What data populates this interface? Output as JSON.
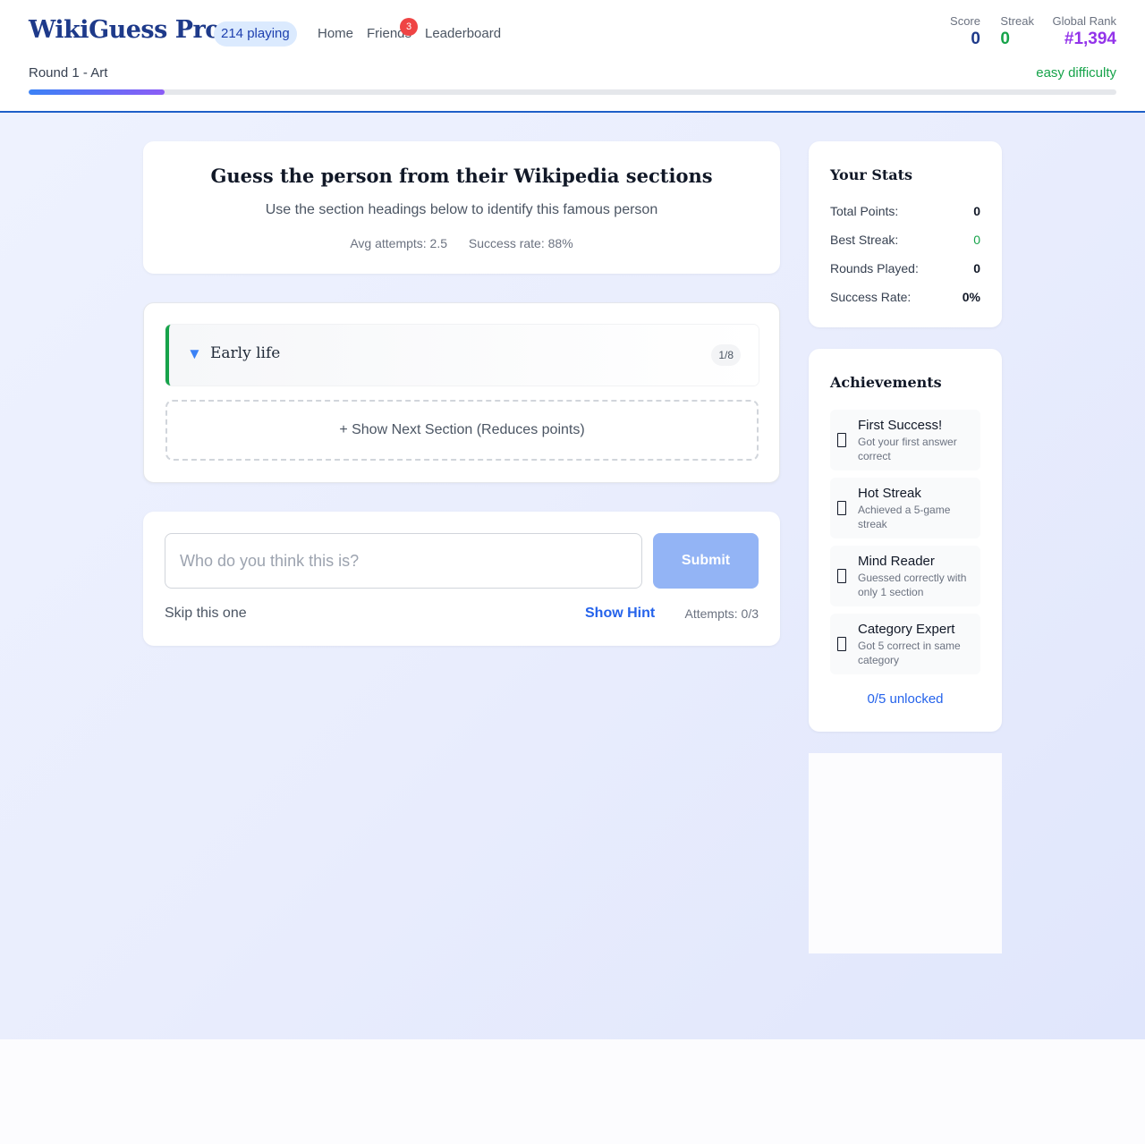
{
  "header": {
    "logo": "WikiGuess Pro",
    "playing_badge": "214 playing",
    "nav": [
      {
        "label": "Home"
      },
      {
        "label": "Friends",
        "notification_count": "3"
      },
      {
        "label": "Leaderboard"
      }
    ],
    "stats": [
      {
        "label": "Score",
        "value": "0",
        "color": "#1e3a8a"
      },
      {
        "label": "Streak",
        "value": "0",
        "color": "#16a34a"
      },
      {
        "label": "Global Rank",
        "value": "#1,394",
        "color": "#9333ea"
      }
    ],
    "round_label": "Round 1 - Art",
    "difficulty": "easy difficulty",
    "progress_fraction": 0.125
  },
  "intro": {
    "title": "Guess the person from their Wikipedia sections",
    "subtitle": "Use the section headings below to identify this famous person",
    "avg_attempts": "Avg attempts: 2.5",
    "success_rate": "Success rate: 88%"
  },
  "sections": {
    "items": [
      {
        "arrow": "▼",
        "title": "Early life",
        "count": "1/8"
      }
    ],
    "show_next_label": "+ Show Next Section (Reduces points)"
  },
  "guess": {
    "placeholder": "Who do you think this is?",
    "submit_label": "Submit",
    "skip_label": "Skip this one",
    "hint_label": " Show Hint",
    "attempts": "Attempts: 0/3"
  },
  "your_stats": {
    "title": "Your Stats",
    "rows": [
      {
        "label": "Total Points:",
        "value": "0"
      },
      {
        "label": "Best Streak:",
        "value": "0",
        "color": "#16a34a"
      },
      {
        "label": "Rounds Played:",
        "value": "0"
      },
      {
        "label": "Success Rate:",
        "value": "0%"
      }
    ]
  },
  "achievements": {
    "title": "Achievements",
    "items": [
      {
        "name": "First Success!",
        "desc": "Got your first answer correct",
        "icon": "locked-badge-icon"
      },
      {
        "name": "Hot Streak",
        "desc": "Achieved a 5-game streak",
        "icon": "locked-badge-icon"
      },
      {
        "name": "Mind Reader",
        "desc": "Guessed correctly with only 1 section",
        "icon": "locked-badge-icon"
      },
      {
        "name": "Category Expert",
        "desc": "Got 5 correct in same category",
        "icon": "locked-badge-icon"
      }
    ],
    "footer": "0/5 unlocked"
  }
}
